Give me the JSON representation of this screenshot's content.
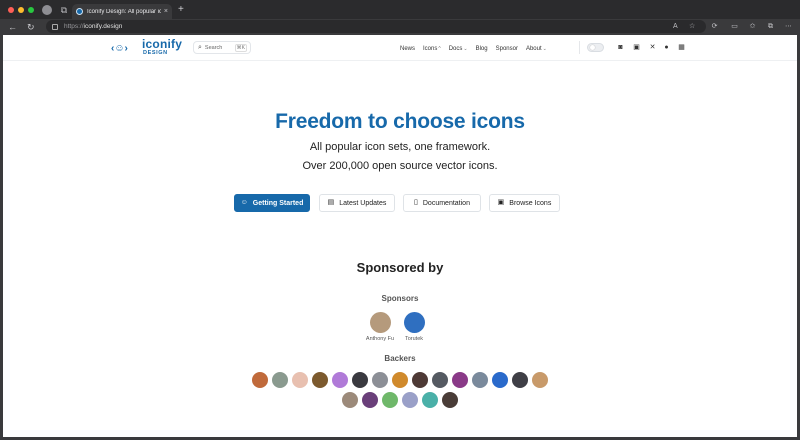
{
  "browser": {
    "tab_title": "Iconify Design: All popular icon",
    "tab_close": "×",
    "new_tab": "+",
    "url_prefix": "https://",
    "url_host": "iconify.design"
  },
  "header": {
    "logo_word": "iconify",
    "logo_sub": "DESIGN",
    "logo_face": "‹☺›",
    "search_label": "Search",
    "search_shortcut": "⌘K",
    "nav": [
      {
        "label": "News",
        "caret": ""
      },
      {
        "label": "Icons",
        "caret": "^"
      },
      {
        "label": "Docs",
        "caret": "⌄"
      },
      {
        "label": "Blog",
        "caret": ""
      },
      {
        "label": "Sponsor",
        "caret": ""
      },
      {
        "label": "About",
        "caret": "⌄"
      }
    ],
    "social_icons": [
      "discord-icon",
      "mastodon-icon",
      "x-icon",
      "github-icon",
      "linkedin-icon"
    ]
  },
  "hero": {
    "title": "Freedom to choose icons",
    "subtitle_1": "All popular icon sets, one framework.",
    "subtitle_2": "Over 200,000 open source vector icons.",
    "buttons": [
      {
        "label": "Getting Started",
        "icon": "☺"
      },
      {
        "label": "Latest Updates",
        "icon": "▤"
      },
      {
        "label": "Documentation",
        "icon": "▯"
      },
      {
        "label": "Browse Icons",
        "icon": "▣"
      }
    ]
  },
  "sponsorship": {
    "heading": "Sponsored by",
    "sponsors_heading": "Sponsors",
    "sponsors": [
      {
        "name": "Anthony Fu",
        "color": "#b59a7c"
      },
      {
        "name": "Torutek",
        "color": "#2f6fc0"
      }
    ],
    "backers_heading": "Backers",
    "backers_row1": [
      "#c06a3b",
      "#8a9a8f",
      "#e8c0b0",
      "#7c5a2e",
      "#b07ad8",
      "#3a3a40",
      "#8c8f96",
      "#d08a2c",
      "#4e3a36",
      "#555a62",
      "#8a3a88",
      "#7a8a9c",
      "#2a6acb",
      "#3f3f46",
      "#c89a6a"
    ],
    "backers_row2": [
      "#9c8a7a",
      "#6a3f7a",
      "#6fb86a",
      "#9aa0c8",
      "#4ab0a8",
      "#4a3d38"
    ]
  },
  "colors": {
    "brand": "#1769aa"
  }
}
